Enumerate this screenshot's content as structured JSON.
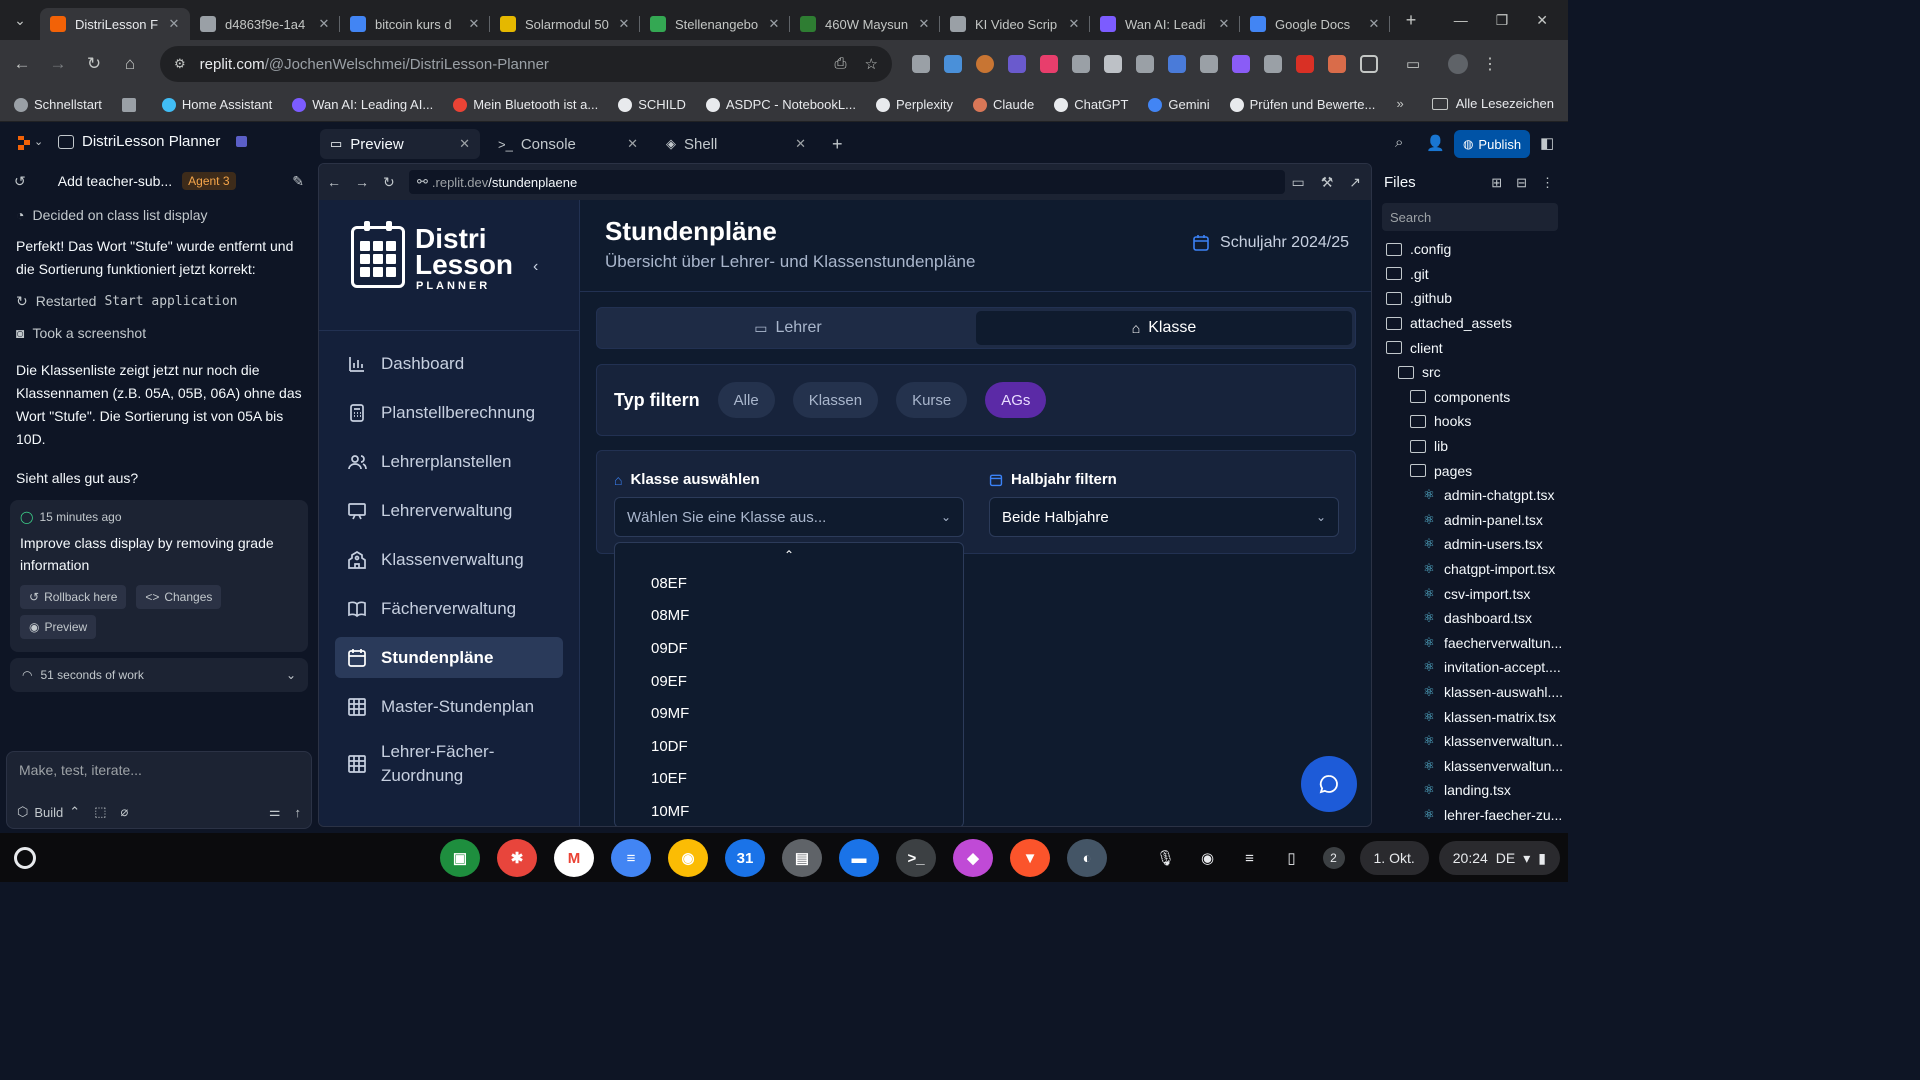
{
  "browser": {
    "tabs": [
      {
        "label": "DistriLesson F",
        "color": "#f26207",
        "active": true
      },
      {
        "label": "d4863f9e-1a4",
        "color": "#9aa0a6"
      },
      {
        "label": "bitcoin kurs d",
        "color": "#4285f4"
      },
      {
        "label": "Solarmodul 50",
        "color": "#e5b800"
      },
      {
        "label": "Stellenangebo",
        "color": "#34a853"
      },
      {
        "label": "460W Maysun",
        "color": "#2e7d32"
      },
      {
        "label": "KI Video Scrip",
        "color": "#9aa0a6"
      },
      {
        "label": "Wan AI: Leadi",
        "color": "#7c5cff"
      },
      {
        "label": "Google Docs",
        "color": "#4285f4"
      }
    ],
    "url_host": "replit.com",
    "url_path": "/@JochenWelschmei/DistriLesson-Planner",
    "bookmarks": [
      {
        "label": "Schnellstart",
        "color": "#9aa0a6"
      },
      {
        "label": "",
        "color": "#9aa0a6"
      },
      {
        "label": "Home Assistant",
        "color": "#41bdf5"
      },
      {
        "label": "Wan AI: Leading AI...",
        "color": "#7c5cff"
      },
      {
        "label": "Mein Bluetooth ist a...",
        "color": "#ea4335"
      },
      {
        "label": "SCHILD",
        "color": "#e8eaed"
      },
      {
        "label": "ASDPC - NotebookL...",
        "color": "#e8eaed"
      },
      {
        "label": "Perplexity",
        "color": "#e8eaed"
      },
      {
        "label": "Claude",
        "color": "#d97757"
      },
      {
        "label": "ChatGPT",
        "color": "#e8eaed"
      },
      {
        "label": "Gemini",
        "color": "#4285f4"
      },
      {
        "label": "Prüfen und Bewerte...",
        "color": "#e8eaed"
      }
    ],
    "all_bookmarks": "Alle Lesezeichen"
  },
  "workspace": {
    "project": "DistriLesson Planner",
    "tabs": [
      {
        "label": "Preview",
        "active": true
      },
      {
        "label": "Console"
      },
      {
        "label": "Shell"
      }
    ],
    "publish": "Publish"
  },
  "agent": {
    "thread_title": "Add teacher-sub...",
    "badge": "Agent 3",
    "decided": "Decided on class list display",
    "msg1": "Perfekt! Das Wort \"Stufe\" wurde entfernt und die Sortierung funktioniert jetzt korrekt:",
    "restarted_prefix": "Restarted",
    "restarted_code": "Start application",
    "screenshot": "Took a screenshot",
    "msg2": "Die Klassenliste zeigt jetzt nur noch die Klassennamen (z.B. 05A, 05B, 06A) ohne das Wort \"Stufe\". Die Sortierung ist von 05A bis 10D.",
    "msg3": "Sieht alles gut aus?",
    "checkpoint_time": "15 minutes ago",
    "checkpoint_title": "Improve class display by removing grade information",
    "rollback": "Rollback here",
    "changes": "Changes",
    "preview": "Preview",
    "work": "51 seconds of work",
    "composer_placeholder": "Make, test, iterate...",
    "build": "Build"
  },
  "preview": {
    "url_host": ".replit.dev",
    "url_path": "/stundenplaene"
  },
  "app": {
    "logo_line1": "Distri",
    "logo_line2": "Lesson",
    "logo_line3": "PLANNER",
    "nav": [
      {
        "label": "Dashboard",
        "icon": "chart-icon"
      },
      {
        "label": "Planstellberechnung",
        "icon": "calculator-icon"
      },
      {
        "label": "Lehrerplanstellen",
        "icon": "users-icon"
      },
      {
        "label": "Lehrerverwaltung",
        "icon": "presentation-icon"
      },
      {
        "label": "Klassenverwaltung",
        "icon": "school-icon"
      },
      {
        "label": "Fächerverwaltung",
        "icon": "book-icon"
      },
      {
        "label": "Stundenpläne",
        "icon": "calendar-icon",
        "active": true
      },
      {
        "label": "Master-Stundenplan",
        "icon": "grid-icon"
      },
      {
        "label": "Lehrer-Fächer-Zuordnung",
        "icon": "grid-icon"
      }
    ],
    "title": "Stundenpläne",
    "subtitle": "Übersicht über Lehrer- und Klassenstundenpläne",
    "school_year": "Schuljahr 2024/25",
    "switch_teacher": "Lehrer",
    "switch_class": "Klasse",
    "filter_label": "Typ filtern",
    "filter_chips": [
      "Alle",
      "Klassen",
      "Kurse",
      "AGs"
    ],
    "active_chip": "AGs",
    "class_select_label": "Klasse auswählen",
    "class_select_placeholder": "Wählen Sie eine Klasse aus...",
    "semester_label": "Halbjahr filtern",
    "semester_value": "Beide Halbjahre",
    "dropdown_options": [
      "08EF",
      "08MF",
      "09DF",
      "09EF",
      "09MF",
      "10DF",
      "10EF",
      "10MF"
    ]
  },
  "files": {
    "title": "Files",
    "search_placeholder": "Search",
    "items": [
      {
        "name": ".config",
        "type": "folder",
        "depth": 0
      },
      {
        "name": ".git",
        "type": "folder",
        "depth": 0
      },
      {
        "name": ".github",
        "type": "folder",
        "depth": 0
      },
      {
        "name": "attached_assets",
        "type": "folder",
        "depth": 0
      },
      {
        "name": "client",
        "type": "folder-open",
        "depth": 0
      },
      {
        "name": "src",
        "type": "folder-open",
        "depth": 1
      },
      {
        "name": "components",
        "type": "folder",
        "depth": 2
      },
      {
        "name": "hooks",
        "type": "folder",
        "depth": 2
      },
      {
        "name": "lib",
        "type": "folder",
        "depth": 2
      },
      {
        "name": "pages",
        "type": "folder-open",
        "depth": 2
      },
      {
        "name": "admin-chatgpt.tsx",
        "type": "file",
        "depth": 3
      },
      {
        "name": "admin-panel.tsx",
        "type": "file",
        "depth": 3
      },
      {
        "name": "admin-users.tsx",
        "type": "file",
        "depth": 3
      },
      {
        "name": "chatgpt-import.tsx",
        "type": "file",
        "depth": 3
      },
      {
        "name": "csv-import.tsx",
        "type": "file",
        "depth": 3
      },
      {
        "name": "dashboard.tsx",
        "type": "file",
        "depth": 3
      },
      {
        "name": "faecherverwaltun...",
        "type": "file",
        "depth": 3
      },
      {
        "name": "invitation-accept....",
        "type": "file",
        "depth": 3
      },
      {
        "name": "klassen-auswahl....",
        "type": "file",
        "depth": 3
      },
      {
        "name": "klassen-matrix.tsx",
        "type": "file",
        "depth": 3
      },
      {
        "name": "klassenverwaltun...",
        "type": "file",
        "depth": 3
      },
      {
        "name": "klassenverwaltun...",
        "type": "file",
        "depth": 3
      },
      {
        "name": "landing.tsx",
        "type": "file",
        "depth": 3
      },
      {
        "name": "lehrer-faecher-zu...",
        "type": "file",
        "depth": 3
      }
    ]
  },
  "taskbar": {
    "apps": [
      {
        "name": "classroom",
        "color": "#1e8e3e",
        "glyph": "▣"
      },
      {
        "name": "paint",
        "color": "#e8453c",
        "glyph": "✱"
      },
      {
        "name": "gmail",
        "color": "#ffffff",
        "glyph": "M"
      },
      {
        "name": "docs",
        "color": "#4285f4",
        "glyph": "≡"
      },
      {
        "name": "chrome",
        "color": "#fbbc04",
        "glyph": "◉"
      },
      {
        "name": "calendar",
        "color": "#1a73e8",
        "glyph": "31"
      },
      {
        "name": "printer",
        "color": "#5f6368",
        "glyph": "▤"
      },
      {
        "name": "files",
        "color": "#1a73e8",
        "glyph": "▬"
      },
      {
        "name": "terminal",
        "color": "#3c4043",
        "glyph": ">_"
      },
      {
        "name": "canvas",
        "color": "#c04ad6",
        "glyph": "◆"
      },
      {
        "name": "brave",
        "color": "#fb542b",
        "glyph": "▼"
      },
      {
        "name": "photo",
        "color": "#445566",
        "glyph": "◐"
      }
    ],
    "notifications": "2",
    "date": "1. Okt.",
    "time": "20:24",
    "locale": "DE"
  }
}
